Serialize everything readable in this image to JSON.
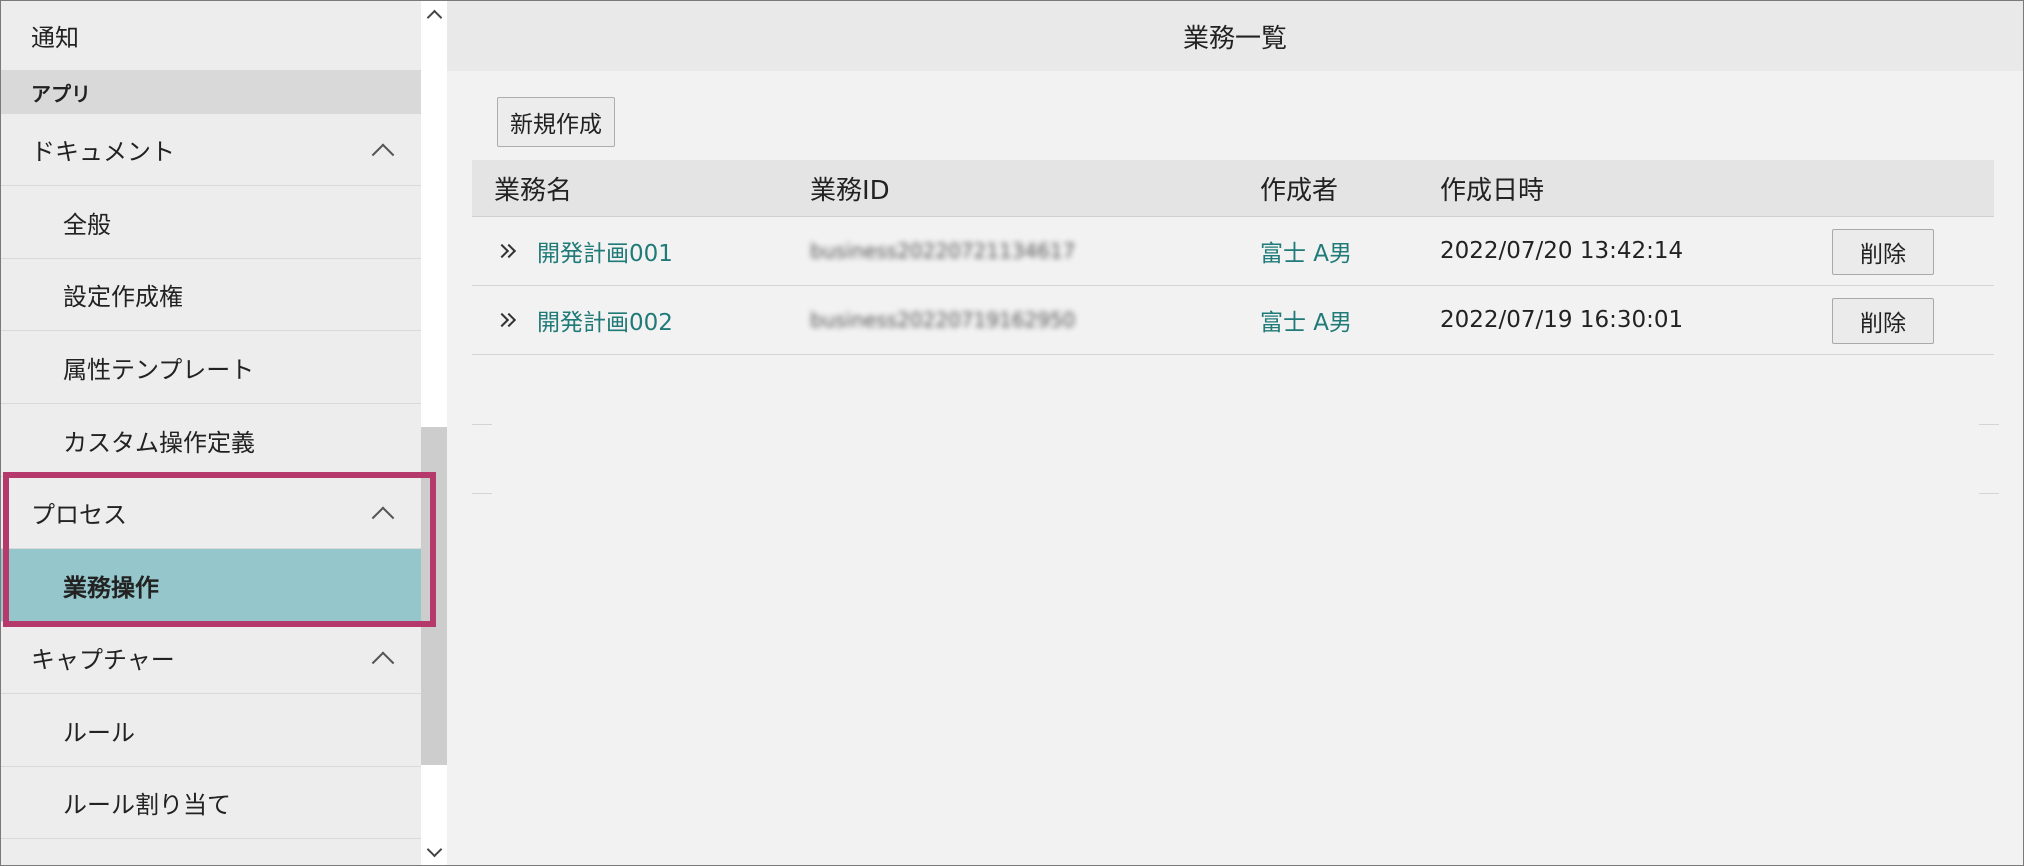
{
  "sidebar": {
    "items": [
      {
        "label": "通知"
      },
      {
        "label": "アプリ"
      },
      {
        "label": "ドキュメント"
      },
      {
        "label": "全般"
      },
      {
        "label": "設定作成権"
      },
      {
        "label": "属性テンプレート"
      },
      {
        "label": "カスタム操作定義"
      },
      {
        "label": "プロセス"
      },
      {
        "label": "業務操作"
      },
      {
        "label": "キャプチャー"
      },
      {
        "label": "ルール"
      },
      {
        "label": "ルール割り当て"
      }
    ],
    "active_item": "業務操作",
    "highlight_color": "#b6396b",
    "active_color": "#95c6cb"
  },
  "main": {
    "title": "業務一覧",
    "new_button": "新規作成",
    "table": {
      "headers": [
        "業務名",
        "業務ID",
        "作成者",
        "作成日時"
      ],
      "rows": [
        {
          "name": "開発計画001",
          "id": "business20220721134617",
          "creator": "富士 A男",
          "created": "2022/07/20 13:42:14",
          "action": "削除"
        },
        {
          "name": "開発計画002",
          "id": "business20220719162950",
          "creator": "富士 A男",
          "created": "2022/07/19 16:30:01",
          "action": "削除"
        }
      ]
    },
    "link_color": "#1f7a78"
  }
}
